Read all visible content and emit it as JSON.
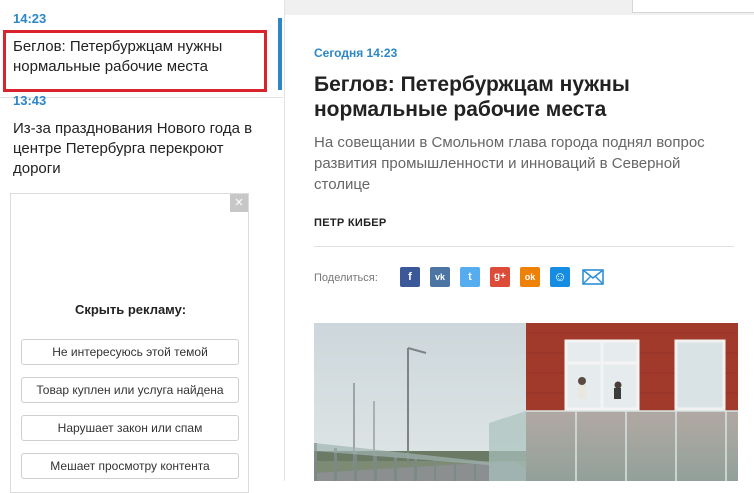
{
  "news_list": {
    "items": [
      {
        "time": "14:23",
        "title": "Беглов: Петербуржцам нужны нормальные рабочие места"
      },
      {
        "time": "13:43",
        "title": "Из-за празднования Нового года в центре Петербурга перекроют дороги"
      }
    ]
  },
  "ad": {
    "close_label": "×",
    "heading": "Скрыть рекламу:",
    "options": [
      "Не интересуюсь этой темой",
      "Товар куплен или услуга найдена",
      "Нарушает закон или спам",
      "Мешает просмотру контента"
    ]
  },
  "article": {
    "date": "Сегодня 14:23",
    "title": "Беглов: Петербуржцам нужны нормальные рабочие места",
    "lead": "На совещании в Смольном глава города поднял вопрос развития промышленности и инноваций в Северной столице",
    "author": "ПЕТР КИБЕР",
    "share_label": "Поделиться:"
  },
  "share_buttons": [
    {
      "icon": "facebook-icon",
      "glyph": "f",
      "color": "#3b5998"
    },
    {
      "icon": "vk-icon",
      "glyph": "vk",
      "color": "#4c75a3"
    },
    {
      "icon": "twitter-icon",
      "glyph": "t",
      "color": "#55acee"
    },
    {
      "icon": "google-plus-icon",
      "glyph": "g+",
      "color": "#dd4b39"
    },
    {
      "icon": "odnoklassniki-icon",
      "glyph": "ok",
      "color": "#ee8208"
    },
    {
      "icon": "moimir-icon",
      "glyph": "☺",
      "color": "#168de2"
    },
    {
      "icon": "email-icon",
      "glyph": "",
      "color": "#2d8fd5"
    }
  ],
  "colors": {
    "accent": "#2b87c8",
    "highlight_border": "#d9232d"
  }
}
